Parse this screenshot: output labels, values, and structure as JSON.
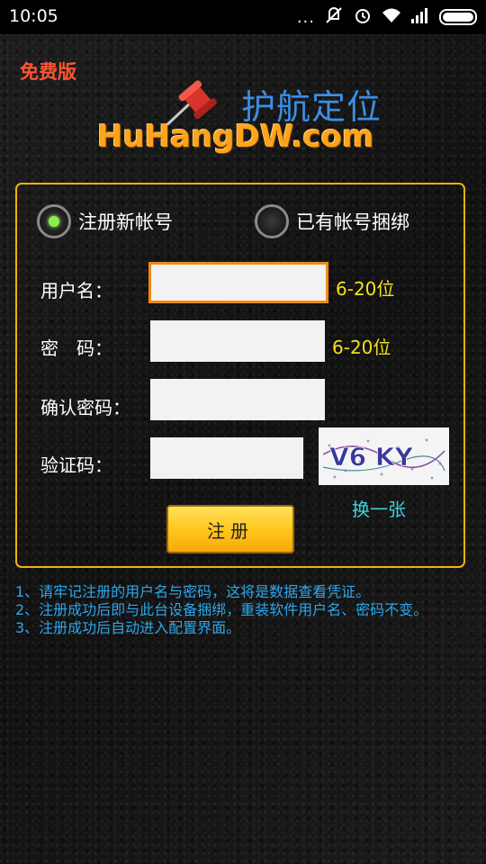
{
  "status_bar": {
    "time": "10:05",
    "more": "...",
    "icons": [
      "mute-icon",
      "alarm-icon",
      "wifi-icon",
      "signal-icon",
      "battery-icon"
    ]
  },
  "header": {
    "free_badge": "免费版",
    "logo_cn": "护航定位",
    "logo_en": "HuHangDW.com"
  },
  "form": {
    "mode_options": [
      {
        "label": "注册新帐号",
        "selected": true
      },
      {
        "label": "已有帐号捆绑",
        "selected": false
      }
    ],
    "username_label": "用户名：",
    "username_value": "",
    "username_hint": "6-20位",
    "password_label": "密　码：",
    "password_value": "",
    "password_hint": "6-20位",
    "confirm_label": "确认密码：",
    "confirm_value": "",
    "captcha_label": "验证码：",
    "captcha_value": "",
    "captcha_text": "V6 KY",
    "refresh_label": "换一张",
    "submit_label": "注册"
  },
  "notes": [
    "1、请牢记注册的用户名与密码，这将是数据查看凭证。",
    "2、注册成功后即与此台设备捆绑，重装软件用户名、密码不变。",
    "3、注册成功后自动进入配置界面。"
  ],
  "colors": {
    "accent": "#f5b20a",
    "hint": "#f3e21a",
    "note": "#2ea6ea",
    "free_badge": "#ff5533"
  }
}
